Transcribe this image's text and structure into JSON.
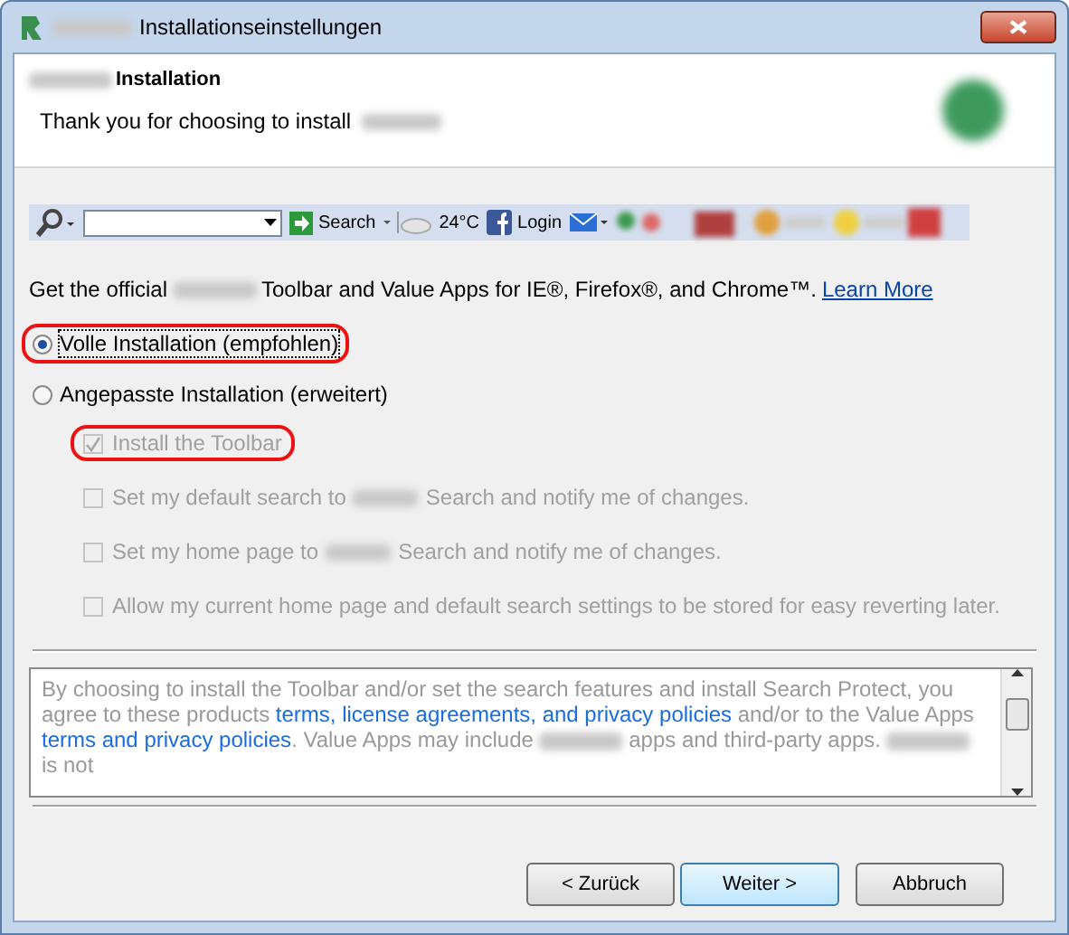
{
  "window": {
    "title": "Installationseinstellungen"
  },
  "header": {
    "title": "Installation",
    "subtitle": "Thank you for choosing to install"
  },
  "toolbar": {
    "search_label": "Search",
    "weather": "24°C",
    "login": "Login"
  },
  "intro": {
    "before": "Get the official",
    "after": "Toolbar and Value Apps for IE®, Firefox®, and Chrome™.",
    "link": "Learn More"
  },
  "options": [
    {
      "label": "Volle Installation (empfohlen)",
      "selected": true,
      "highlighted": true,
      "focused": true
    },
    {
      "label": "Angepasste Installation (erweitert)",
      "selected": false,
      "highlighted": false,
      "focused": false
    }
  ],
  "checkboxes": [
    {
      "parts": [
        "Install the Toolbar"
      ],
      "checked": true,
      "disabled": true,
      "highlighted": true
    },
    {
      "parts": [
        "Set my default search to",
        "Search and notify me of changes."
      ],
      "checked": false,
      "disabled": true,
      "highlighted": false
    },
    {
      "parts": [
        "Set my home page to",
        "Search and notify me of changes."
      ],
      "checked": false,
      "disabled": true,
      "highlighted": false
    },
    {
      "parts": [
        "Allow my current home page and default search settings to be stored for easy reverting later."
      ],
      "checked": false,
      "disabled": true,
      "highlighted": false
    }
  ],
  "legal": [
    {
      "kind": "text",
      "text": "By choosing to install the Toolbar and/or set the search features and install Search Protect, you agree to these products "
    },
    {
      "kind": "link",
      "text": "terms, license agreements, and privacy policies"
    },
    {
      "kind": "text",
      "text": " and/or to the Value Apps "
    },
    {
      "kind": "link",
      "text": "terms and privacy policies"
    },
    {
      "kind": "text",
      "text": ". Value Apps may include "
    },
    {
      "kind": "redacted"
    },
    {
      "kind": "text",
      "text": " apps and third-party apps. "
    },
    {
      "kind": "redacted"
    },
    {
      "kind": "text",
      "text": " is not"
    }
  ],
  "buttons": [
    {
      "label": "< Zurück",
      "default": false
    },
    {
      "label": "Weiter >",
      "default": true
    },
    {
      "label": "Abbruch",
      "default": false
    }
  ]
}
